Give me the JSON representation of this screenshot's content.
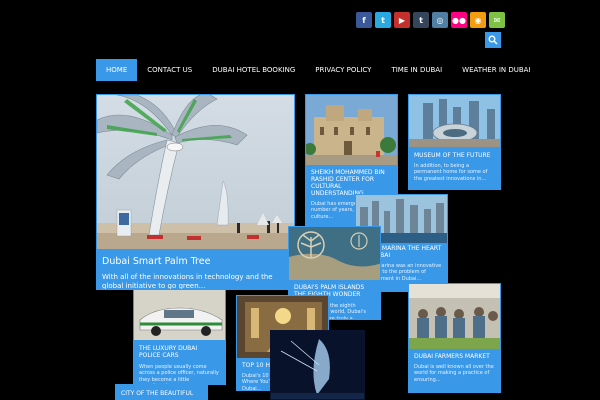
{
  "social": [
    {
      "icon": "facebook-icon",
      "glyph": "f",
      "color": "#3b5998"
    },
    {
      "icon": "twitter-icon",
      "glyph": "t",
      "color": "#2aa9e0"
    },
    {
      "icon": "youtube-icon",
      "glyph": "▶",
      "color": "#c4302b"
    },
    {
      "icon": "tumblr-icon",
      "glyph": "t",
      "color": "#35465c"
    },
    {
      "icon": "instagram-icon",
      "glyph": "◎",
      "color": "#517fa4"
    },
    {
      "icon": "flickr-icon",
      "glyph": "●●",
      "color": "#ff0084"
    },
    {
      "icon": "rss-icon",
      "glyph": "◉",
      "color": "#f39c12"
    },
    {
      "icon": "email-icon",
      "glyph": "✉",
      "color": "#7dc242"
    }
  ],
  "nav": {
    "items": [
      "HOME",
      "CONTACT US",
      "DUBAI HOTEL BOOKING",
      "PRIVACY POLICY",
      "TIME IN DUBAI",
      "WEATHER IN DUBAI"
    ]
  },
  "posts": {
    "palm": {
      "title": "Dubai Smart Palm Tree",
      "excerpt": "With all of the innovations in technology and the global initiative to go green..."
    },
    "sheikh": {
      "title": "SHEIKH MOHAMMED BIN RASHID CENTER FOR CULTURAL UNDERSTANDING",
      "excerpt": "Dubai has emerged over a number of years, with a culture..."
    },
    "museum": {
      "title": "MUSEUM OF THE FUTURE",
      "excerpt": "In addition, to being a permanent home for some of the greatest innovations in..."
    },
    "marina": {
      "title": "DUBAI MARINA THE HEART OF DUBAI",
      "excerpt": "Dubai Marina was an innovative solution to the problem of development in Dubai..."
    },
    "palmislands": {
      "title": "DUBAI'S PALM ISLANDS THE EIGHTH WONDER",
      "excerpt": "Often dubbed the eighth wonder of the world, Dubai's Palm Islands are truly a..."
    },
    "police": {
      "title": "THE LUXURY DUBAI POLICE CARS",
      "excerpt": "When people usually come across a police officer, naturally they become a little apprehensive..."
    },
    "top10": {
      "title": "TOP 10 HOTELS IN DUBAI",
      "excerpt": "Dubai's 10 best hotels are... Where You'll find... Royalty Dubai..."
    },
    "city": {
      "title": "CITY OF THE BEAUTIFUL"
    },
    "farmers": {
      "title": "DUBAI FARMERS MARKET",
      "excerpt": "Dubai is well known all over the world for making a practice of ensuring..."
    }
  },
  "colors": {
    "accent": "#3a98e8",
    "background": "#000000"
  }
}
